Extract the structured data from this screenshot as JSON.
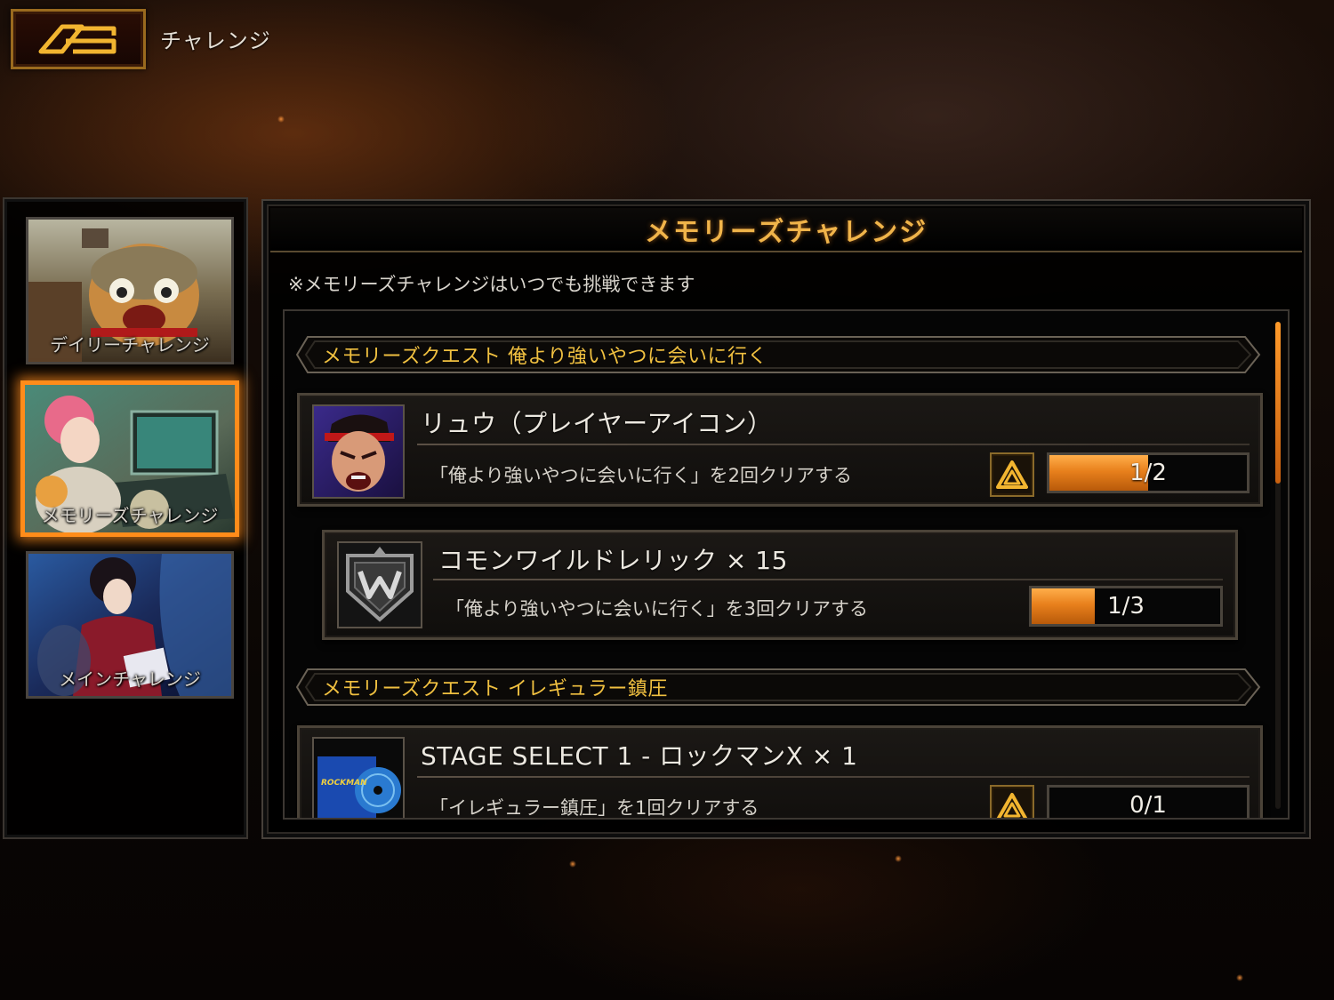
{
  "header": {
    "back_icon": "back-emblem-icon",
    "title": "チャレンジ"
  },
  "sidebar": {
    "items": [
      {
        "label": "デイリーチャレンジ",
        "active": false
      },
      {
        "label": "メモリーズチャレンジ",
        "active": true
      },
      {
        "label": "メインチャレンジ",
        "active": false
      }
    ]
  },
  "panel": {
    "title": "メモリーズチャレンジ",
    "note": "※メモリーズチャレンジはいつでも挑戦できます"
  },
  "quests": [
    {
      "title": "メモリーズクエスト 俺より強いやつに会いに行く",
      "rewards": [
        {
          "name": "リュウ（プレイヤーアイコン）",
          "condition": "「俺より強いやつに会いに行く」を2回クリアする",
          "progress_text": "1/2",
          "progress": 0.5,
          "has_rank_icon": true
        },
        {
          "name": "コモンワイルドレリック × 15",
          "condition": "「俺より強いやつに会いに行く」を3回クリアする",
          "progress_text": "1/3",
          "progress": 0.333,
          "has_rank_icon": false
        }
      ]
    },
    {
      "title": "メモリーズクエスト イレギュラー鎮圧",
      "rewards": [
        {
          "name": "STAGE SELECT 1 - ロックマンX × 1",
          "condition": "「イレギュラー鎮圧」を1回クリアする",
          "progress_text": "0/1",
          "progress": 0,
          "has_rank_icon": true,
          "icon_text": "ROCKMAN"
        }
      ]
    }
  ],
  "colors": {
    "accent": "#ff8c1a",
    "gold_text": "#f0c040",
    "progress_fill": "#e8801c"
  }
}
